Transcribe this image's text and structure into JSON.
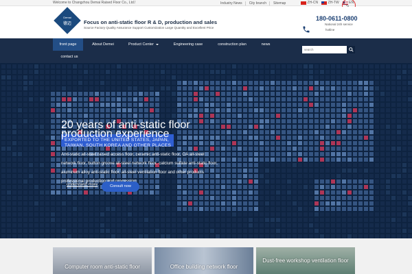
{
  "topbar": {
    "welcome": "Welcome to Changzhou Demai Raised Floor Co., Ltd.!",
    "links": [
      "Industry News",
      "City branch",
      "Sitemap"
    ],
    "languages": [
      {
        "code": "ZH-CN",
        "flag": "cn"
      },
      {
        "code": "ZH-TW",
        "flag": "tw"
      },
      {
        "code": "EN",
        "flag": "en"
      }
    ]
  },
  "header": {
    "logo_text_en": "Demai",
    "logo_text_cn": "德迈",
    "title": "Focus on anti-static floor R & D, production and sales",
    "subtitle": "Source Factory Quality Assurance Support Customization Large Quantity and Excellent Price",
    "phone_icon": "phone-icon",
    "phone": "180-0611-0800",
    "phone_note": "National 24h service",
    "phone_note2": "hotline"
  },
  "nav": {
    "items": [
      "front page",
      "About Demei",
      "Product Center",
      "Engineering case",
      "construction plan",
      "news",
      "contact us"
    ],
    "search_placeholder": "search"
  },
  "hero": {
    "title": "20 years of anti-static floor production experience",
    "badge": "EXPORTED TO THE UNITED STATES, JAPAN, TAIWAN, SOUTH KOREA AND OTHER PLACES",
    "description": "Anti-static all-steel raised access floor, ceramic anti-static floor, OA all-steel network floor, button groove all-steel network floor, calcium sulfate anti-static floor, aluminum alloy anti-static floor, all-steel ventilation floor and other products professional production and processing",
    "link_label": "understand more",
    "button_label": "Consult now"
  },
  "products": [
    {
      "label": "Computer room anti-static floor"
    },
    {
      "label": "Office building network floor"
    },
    {
      "label": "Dust-free workshop ventilation floor"
    }
  ],
  "colors": {
    "nav_bg": "#1b2d49",
    "nav_active": "#234e86",
    "accent": "#2c5fc7",
    "hero_bg": "#0e2340"
  }
}
